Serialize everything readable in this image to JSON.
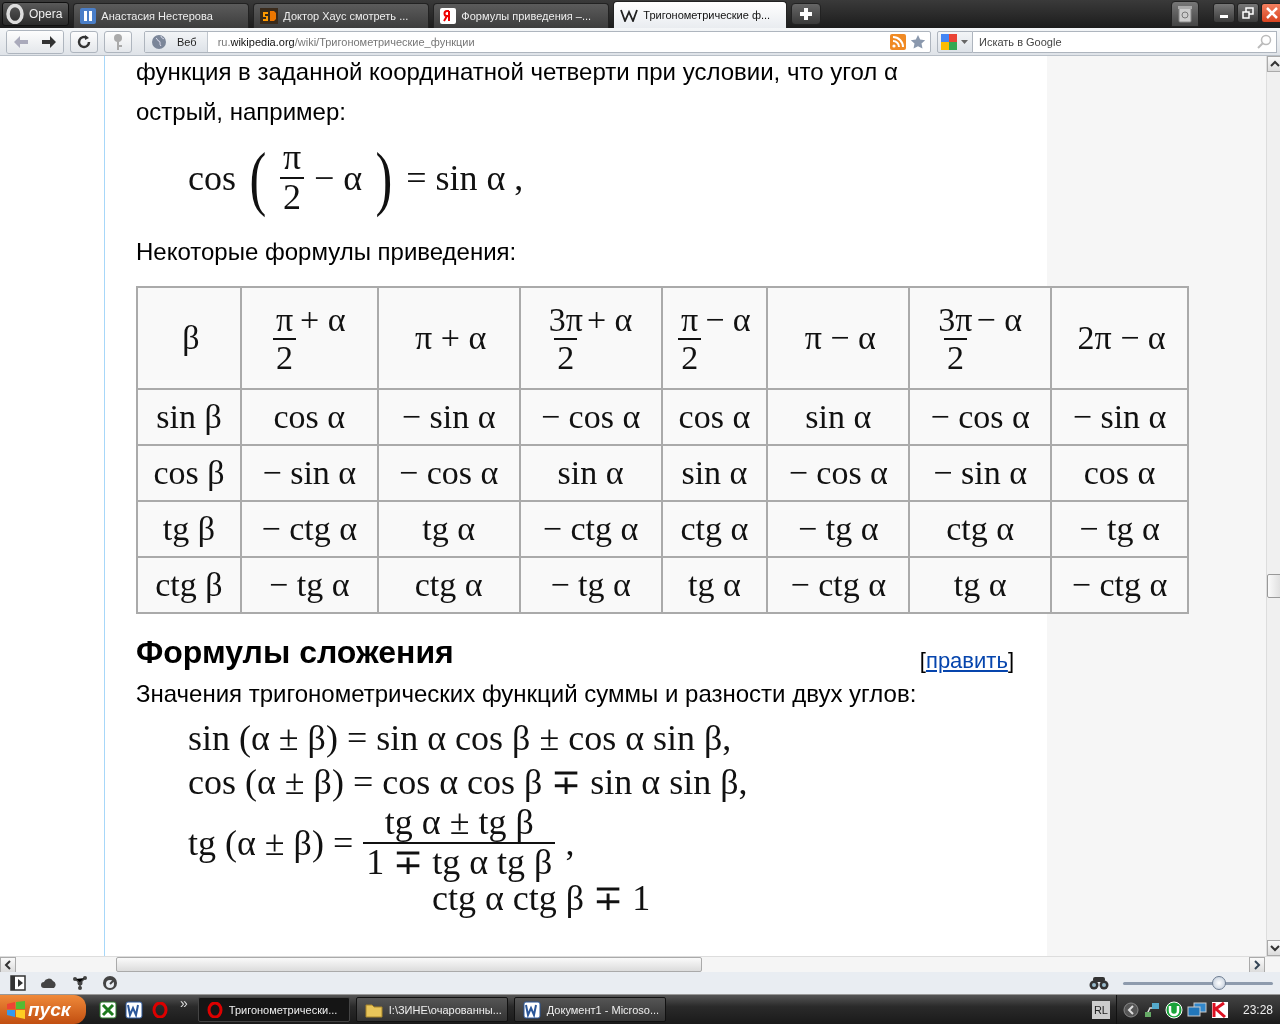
{
  "browser": {
    "menu_button": "Opera",
    "tabs": [
      {
        "title": "Анастасия Нестерова",
        "selected": false
      },
      {
        "title": "Доктор Хаус смотреть ...",
        "selected": false
      },
      {
        "title": "Формулы приведения –...",
        "selected": false
      },
      {
        "title": "Тригонометрические ф...",
        "selected": true
      }
    ],
    "address": {
      "badge": "Веб",
      "url_prefix": "ru.",
      "url_domain": "wikipedia.org",
      "url_path": "/wiki/Тригонометрические_функции"
    },
    "search": {
      "placeholder": "Искать в Google"
    }
  },
  "article": {
    "paragraph_cut": "функция в заданной координатной четверти при условии, что угол α",
    "paragraph": "острый, например:",
    "formula": [
      {
        "kind": "text",
        "text": "cos"
      },
      {
        "kind": "paren",
        "text": "("
      },
      {
        "kind": "frac",
        "num": "π",
        "den": "2"
      },
      {
        "kind": "text",
        "text": "− α"
      },
      {
        "kind": "paren",
        "text": ")"
      },
      {
        "kind": "text",
        "text": "= sin α ,"
      }
    ],
    "table_caption": "Некоторые формулы приведения:",
    "table": {
      "header": [
        [
          {
            "kind": "text",
            "text": "β"
          }
        ],
        [
          {
            "kind": "frac",
            "num": "π",
            "den": "2"
          },
          {
            "kind": "text",
            "text": "+ α"
          }
        ],
        [
          {
            "kind": "text",
            "text": "π + α"
          }
        ],
        [
          {
            "kind": "frac",
            "num": "3π",
            "den": "2"
          },
          {
            "kind": "text",
            "text": "+ α"
          }
        ],
        [
          {
            "kind": "frac",
            "num": "π",
            "den": "2"
          },
          {
            "kind": "text",
            "text": "− α"
          }
        ],
        [
          {
            "kind": "text",
            "text": "π − α"
          }
        ],
        [
          {
            "kind": "frac",
            "num": "3π",
            "den": "2"
          },
          {
            "kind": "text",
            "text": "− α"
          }
        ],
        [
          {
            "kind": "text",
            "text": "2π − α"
          }
        ]
      ],
      "rows": [
        [
          "sin β",
          "cos α",
          "− sin α",
          "− cos α",
          "cos α",
          "sin α",
          "− cos α",
          "− sin α"
        ],
        [
          "cos β",
          "− sin α",
          "− cos α",
          "sin α",
          "sin α",
          "− cos α",
          "− sin α",
          "cos α"
        ],
        [
          "tg β",
          "− ctg α",
          "tg α",
          "− ctg α",
          "ctg α",
          "− tg α",
          "ctg α",
          "− tg α"
        ],
        [
          "ctg β",
          "− tg α",
          "ctg α",
          "− tg α",
          "tg α",
          "− ctg α",
          "tg α",
          "− ctg α"
        ]
      ]
    },
    "section": {
      "heading": "Формулы сложения",
      "edit_open": "[",
      "edit_link": "править",
      "edit_close": "]"
    },
    "section_paragraph": "Значения тригонометрических функций суммы и разности двух углов:",
    "formulas": [
      [
        {
          "kind": "text",
          "text": "sin (α ± β) = sin α cos β ± cos α sin β,"
        }
      ],
      [
        {
          "kind": "text",
          "text": "cos (α ± β) = cos α cos β ∓ sin α sin β,"
        }
      ],
      [
        {
          "kind": "text",
          "text": "tg (α ± β) ="
        },
        {
          "kind": "frac",
          "num": "tg α ± tg β",
          "den": "1 ∓ tg α tg β"
        },
        {
          "kind": "text",
          "text": ","
        }
      ]
    ],
    "cut_line": "ctg α ctg β ∓ 1"
  },
  "status_bar": {
    "zoom": {
      "level": 0.64
    }
  },
  "taskbar": {
    "start": "пуск",
    "more": "»",
    "tasks": [
      {
        "title": "Тригонометрически...",
        "selected": true
      },
      {
        "title": "I:\\ЗИНЕ\\очарованны...",
        "selected": false
      },
      {
        "title": "Документ1 - Microso...",
        "selected": false
      }
    ],
    "language": "RL",
    "clock": "23:28"
  }
}
